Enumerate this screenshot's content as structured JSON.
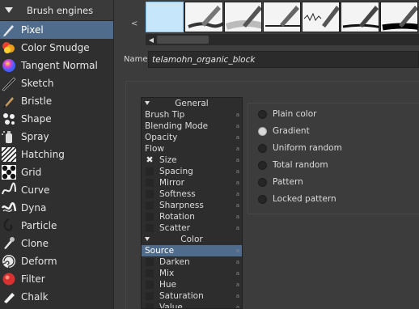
{
  "engines": {
    "title": "Brush engines",
    "items": [
      {
        "label": "Pixel",
        "icon": "pixel-icon",
        "selected": true
      },
      {
        "label": "Color Smudge",
        "icon": "color-smudge-icon"
      },
      {
        "label": "Tangent Normal",
        "icon": "tangent-normal-icon"
      },
      {
        "label": "Sketch",
        "icon": "sketch-icon"
      },
      {
        "label": "Bristle",
        "icon": "bristle-icon"
      },
      {
        "label": "Shape",
        "icon": "shape-icon"
      },
      {
        "label": "Spray",
        "icon": "spray-icon"
      },
      {
        "label": "Hatching",
        "icon": "hatching-icon"
      },
      {
        "label": "Grid",
        "icon": "grid-icon"
      },
      {
        "label": "Curve",
        "icon": "curve-icon"
      },
      {
        "label": "Dyna",
        "icon": "dyna-icon"
      },
      {
        "label": "Particle",
        "icon": "particle-icon"
      },
      {
        "label": "Clone",
        "icon": "clone-icon"
      },
      {
        "label": "Deform",
        "icon": "deform-icon"
      },
      {
        "label": "Filter",
        "icon": "filter-icon"
      },
      {
        "label": "Chalk",
        "icon": "chalk-icon"
      }
    ]
  },
  "presets": {
    "scroll_left_glyph": "<",
    "scrollbar_left_glyph": "◀",
    "thumbnails": [
      "blank-preset-thumbnail",
      "pen-stroke-thumbnail",
      "pen-wash-thumbnail",
      "pen-line-thumbnail",
      "pen-scribble-thumbnail",
      "pen-ink-thumbnail",
      "pen-bold-thumbnail"
    ]
  },
  "name": {
    "label": "Name:",
    "value": "telamohn_organic_block"
  },
  "options": {
    "items": [
      {
        "label": "General",
        "type": "header"
      },
      {
        "label": "Brush Tip",
        "type": "item"
      },
      {
        "label": "Blending Mode",
        "type": "item"
      },
      {
        "label": "Opacity",
        "type": "item"
      },
      {
        "label": "Flow",
        "type": "item"
      },
      {
        "label": "Size",
        "type": "sub",
        "checked": true
      },
      {
        "label": "Spacing",
        "type": "sub"
      },
      {
        "label": "Mirror",
        "type": "sub"
      },
      {
        "label": "Softness",
        "type": "sub"
      },
      {
        "label": "Sharpness",
        "type": "sub"
      },
      {
        "label": "Rotation",
        "type": "sub"
      },
      {
        "label": "Scatter",
        "type": "sub"
      },
      {
        "label": "Color",
        "type": "header"
      },
      {
        "label": "Source",
        "type": "item",
        "selected": true
      },
      {
        "label": "Darken",
        "type": "sub"
      },
      {
        "label": "Mix",
        "type": "sub"
      },
      {
        "label": "Hue",
        "type": "sub"
      },
      {
        "label": "Saturation",
        "type": "sub"
      },
      {
        "label": "Value",
        "type": "sub"
      }
    ],
    "lock_glyph": "🔒",
    "check_glyph": "✖"
  },
  "source": {
    "options": [
      "Plain color",
      "Gradient",
      "Uniform random",
      "Total random",
      "Pattern",
      "Locked pattern"
    ],
    "selected": "Gradient"
  },
  "colors": {
    "selection": "#4f6c8c",
    "preset_selected": "#c6e6fb"
  }
}
